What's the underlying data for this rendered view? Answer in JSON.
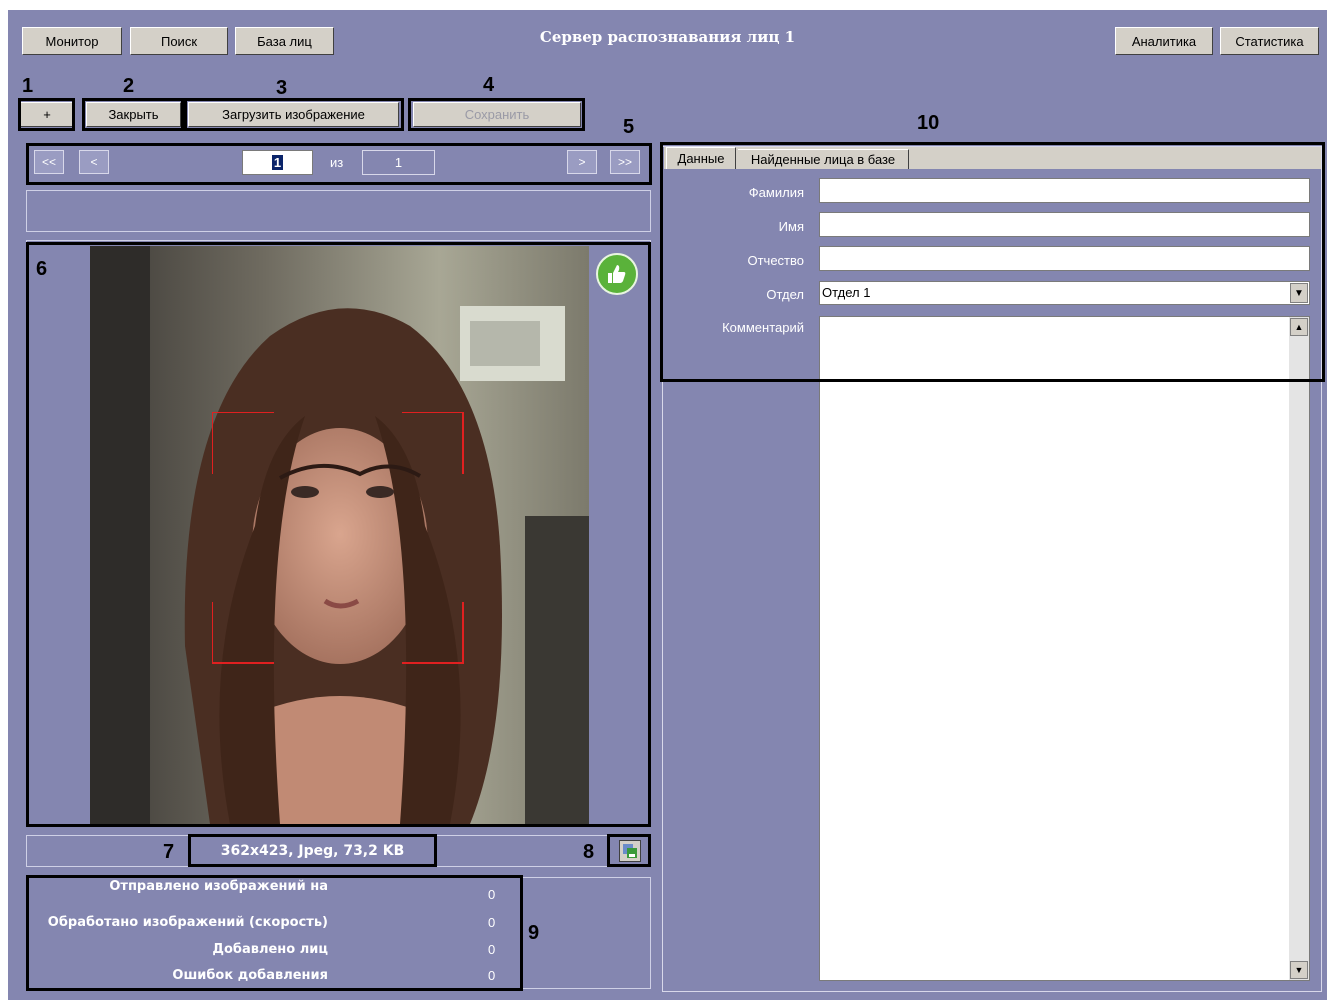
{
  "window": {
    "title": "Сервер распознавания лиц 1"
  },
  "topnav": {
    "monitor": "Монитор",
    "search": "Поиск",
    "facebase": "База лиц",
    "analytics": "Аналитика",
    "statistics": "Статистика"
  },
  "toolbar": {
    "add": "+",
    "close": "Закрыть",
    "load_image": "Загрузить изображение",
    "save": "Сохранить"
  },
  "pager": {
    "first": "<<",
    "prev": "<",
    "current": "1",
    "of": "из",
    "total": "1",
    "next": ">",
    "last": ">>"
  },
  "callouts": {
    "n1": "1",
    "n2": "2",
    "n3": "3",
    "n4": "4",
    "n5": "5",
    "n6": "6",
    "n7": "7",
    "n8": "8",
    "n9": "9",
    "n10": "10"
  },
  "image_info": "362x423, Jpeg, 73,2 KB",
  "stats": [
    {
      "label": "Отправлено изображений на",
      "value": "0"
    },
    {
      "label": "Обработано изображений (скорость)",
      "value": "0"
    },
    {
      "label": "Добавлено лиц",
      "value": "0"
    },
    {
      "label": "Ошибок добавления",
      "value": "0"
    }
  ],
  "tabs": {
    "data": "Данные",
    "found": "Найденные лица в базе"
  },
  "form": {
    "surname_label": "Фамилия",
    "surname_value": "",
    "name_label": "Имя",
    "name_value": "",
    "patronymic_label": "Отчество",
    "patronymic_value": "",
    "department_label": "Отдел",
    "department_value": "Отдел 1",
    "comment_label": "Комментарий",
    "comment_value": ""
  },
  "icons": {
    "like": "thumbs-up-icon",
    "export": "save-image-icon"
  },
  "colors": {
    "panel_bg": "#8486b0",
    "like_green": "#5ab23a",
    "face_box": "#e02020"
  }
}
